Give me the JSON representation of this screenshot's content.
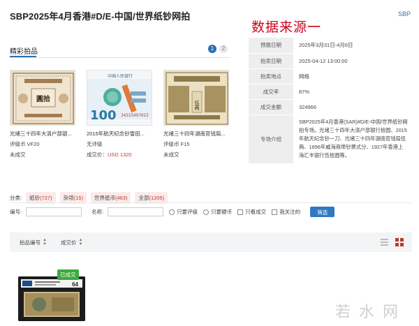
{
  "header": {
    "title": "SBP2025年4月香港#D/E-中国/世界纸钞网拍",
    "red_note": "数据来源一",
    "brand_link": "SBP"
  },
  "featured": {
    "label": "精彩拍品",
    "pages": [
      "1",
      "2"
    ],
    "items": [
      {
        "name": "光绪三十四年大清户部银...",
        "line1": "评级币 VF20",
        "line2": "未成交"
      },
      {
        "name": "2015年航天纪念钞雪田...",
        "line1": "无评级",
        "line2_prefix": "成交价：",
        "line2_value": "USD 1320"
      },
      {
        "name": "光绪三十四年湖南官钱局...",
        "line1": "评级币 F15",
        "line2": "未成交"
      }
    ],
    "item_images": {
      "0_text": "圓拾",
      "1_text": "100",
      "1_header": "中国人民银行",
      "1_serial": "J4315497022",
      "2_text": "伍两"
    }
  },
  "info": {
    "rows": [
      {
        "k": "预展日期",
        "v": "2025年3月31日-4月6日"
      },
      {
        "k": "拍卖日期",
        "v": "2025-04-12 13:00:00"
      },
      {
        "k": "拍卖地点",
        "v": "网络"
      },
      {
        "k": "成交率",
        "v": "87%"
      },
      {
        "k": "成交金额",
        "v": "324966"
      }
    ],
    "desc_label": "专场介绍",
    "desc_text": "SBP2025年4月香港(SAR)#D/E-中国/世界纸钞网拍专场。光绪三十四年大清户部银行拾圆、2015年航天纪念钞一刀、光绪三十四年湖南官钱局伍两、1896年威海商埠钞票式分、1927年香港上海汇丰银行伍拾圆等。"
  },
  "filters": {
    "label": "分类:",
    "chips": [
      {
        "name": "纸钞",
        "count": "(727)"
      },
      {
        "name": "杂项",
        "count": "(15)"
      },
      {
        "name": "世界纸币",
        "count": "(463)"
      },
      {
        "name": "全部",
        "count": "(1205)"
      }
    ]
  },
  "search": {
    "lot_label": "编号:",
    "name_label": "名称:",
    "options": [
      "只要评级",
      "只要硬币",
      "只看成交",
      "我关注的"
    ],
    "button": "筛选"
  },
  "list": {
    "col1": "拍品编号",
    "col2": "成交价",
    "sort_icon": "sort-icon"
  },
  "result": {
    "badge": "已成交",
    "grade": "64"
  },
  "watermark": "若水网",
  "colors": {
    "accent": "#2a6fb5",
    "red": "#c0392b",
    "green": "#3da93d"
  }
}
